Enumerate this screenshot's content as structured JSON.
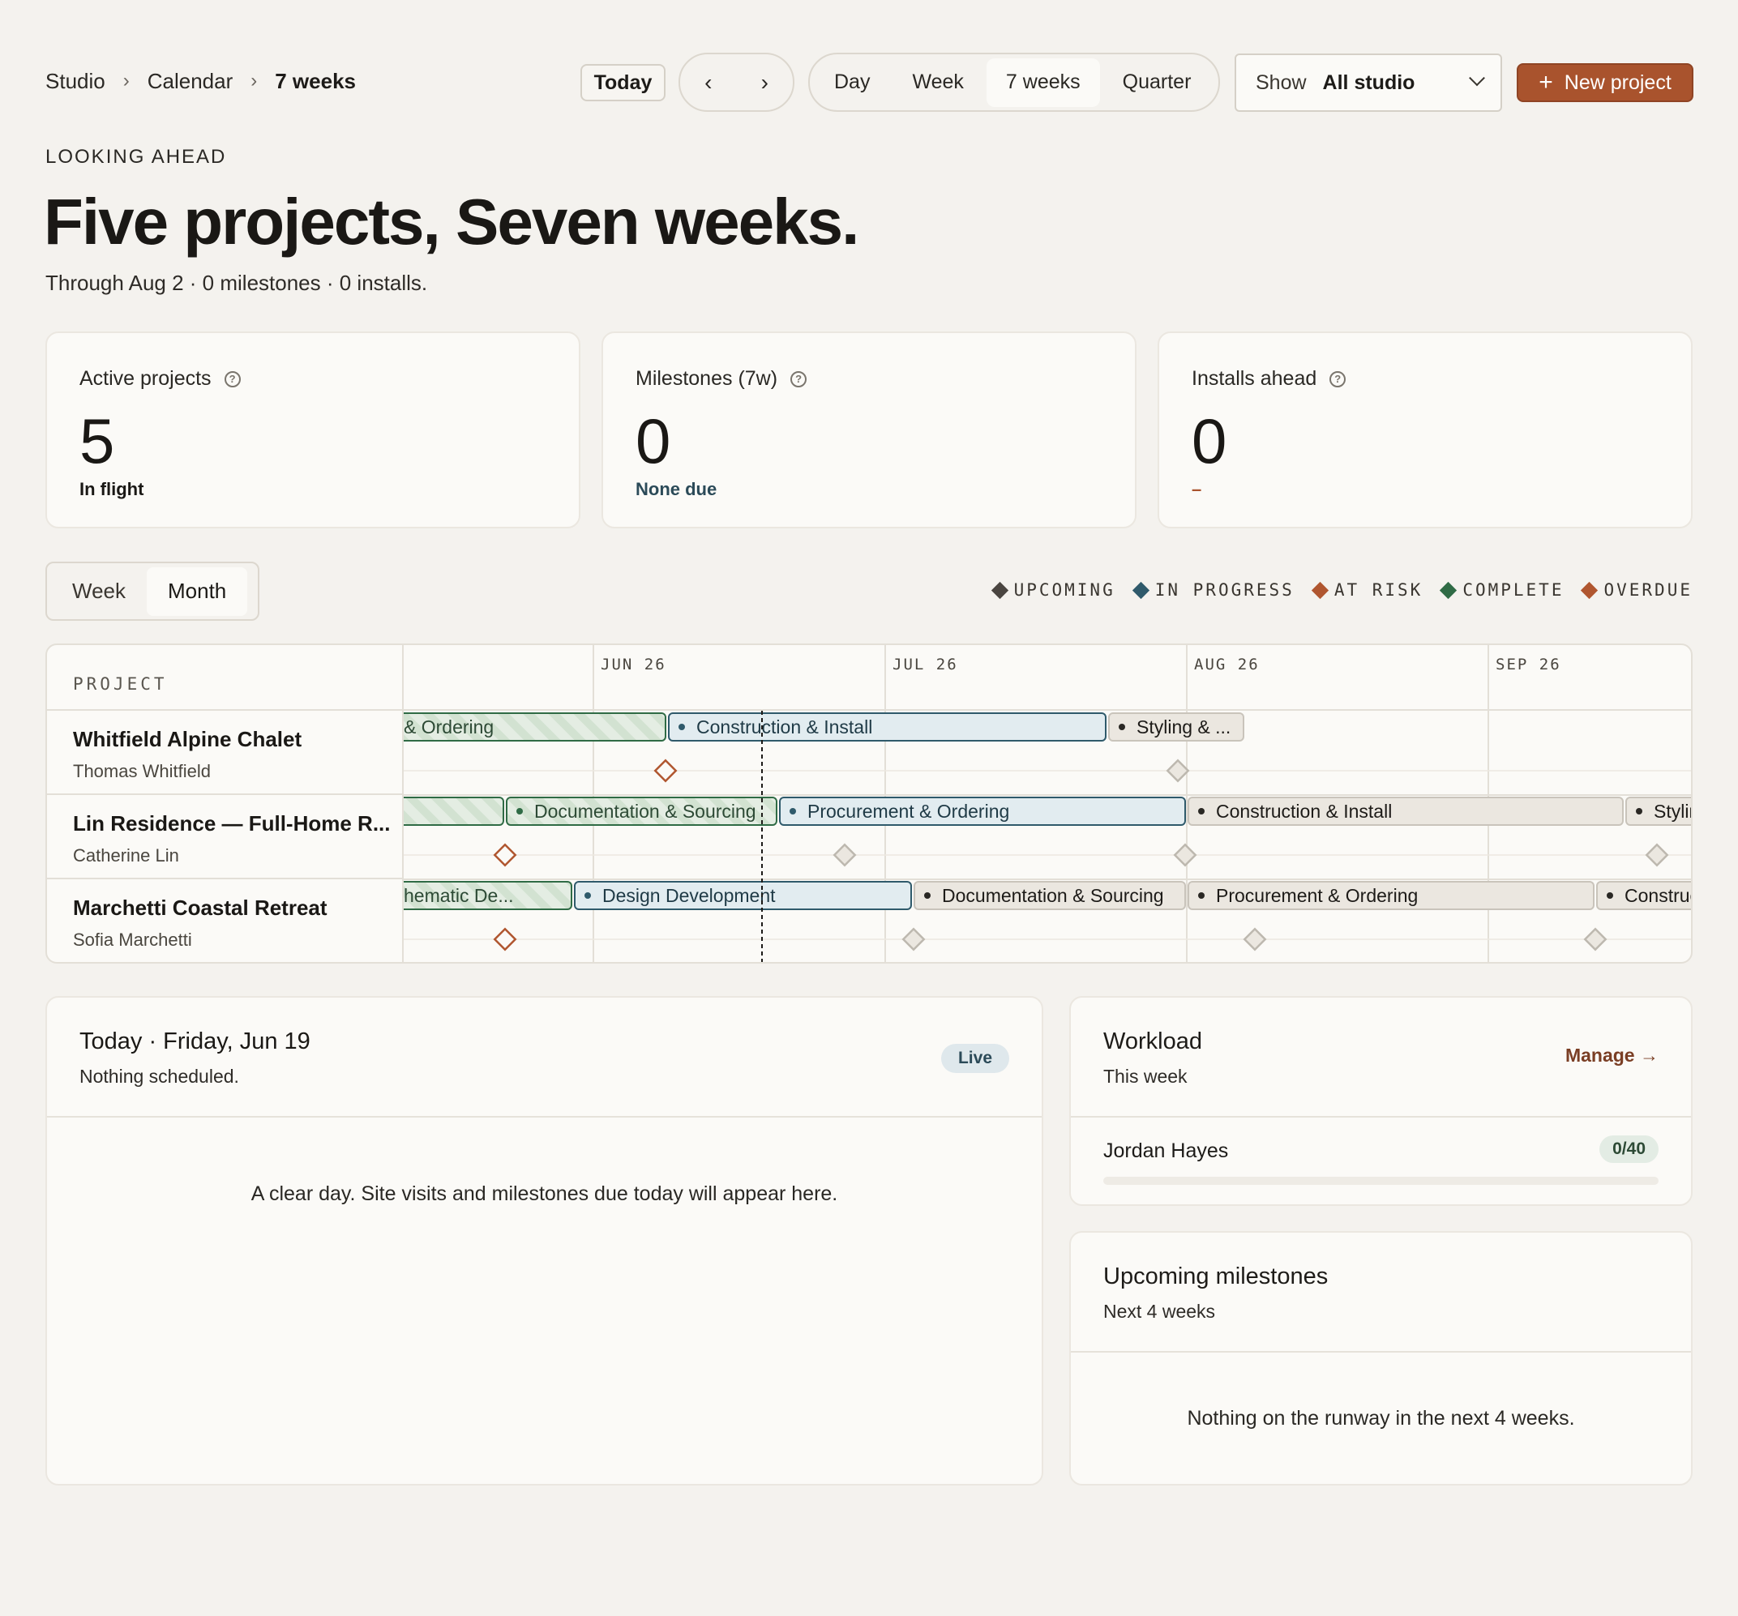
{
  "breadcrumb": {
    "items": [
      "Studio",
      "Calendar",
      "7 weeks"
    ]
  },
  "toolbar": {
    "today_label": "Today",
    "prev_label": "‹",
    "next_label": "›",
    "views": [
      "Day",
      "Week",
      "7 weeks",
      "Quarter"
    ],
    "active_view": "7 weeks",
    "show_label": "Show",
    "show_value": "All studio",
    "new_project_label": "New project"
  },
  "header": {
    "eyebrow": "LOOKING AHEAD",
    "title": "Five projects, Seven weeks.",
    "subtitle": "Through Aug 2 · 0 milestones · 0 installs."
  },
  "stats": [
    {
      "title": "Active projects",
      "value": "5",
      "note": "In flight",
      "note_color": "#1a1815"
    },
    {
      "title": "Milestones (7w)",
      "value": "0",
      "note": "None due",
      "note_color": "#2b4a58"
    },
    {
      "title": "Installs ahead",
      "value": "0",
      "note": "–",
      "note_color": "#a9532d"
    }
  ],
  "timeline": {
    "scale_options": [
      "Week",
      "Month"
    ],
    "active_scale": "Month",
    "legend": [
      {
        "label": "UPCOMING",
        "color": "#4a4540"
      },
      {
        "label": "IN PROGRESS",
        "color": "#2f5a6b"
      },
      {
        "label": "AT RISK",
        "color": "#b0562f"
      },
      {
        "label": "COMPLETE",
        "color": "#2f6b45"
      },
      {
        "label": "OVERDUE",
        "color": "#b0562f"
      }
    ],
    "project_header": "PROJECT",
    "months": [
      "JUN 26",
      "JUL 26",
      "AUG 26",
      "SEP 26"
    ],
    "projects": [
      {
        "name": "Whitfield Alpine Chalet",
        "client": "Thomas Whitfield",
        "phases": [
          {
            "label": "& Ordering",
            "status": "complete"
          },
          {
            "label": "Construction & Install",
            "status": "in-progress"
          },
          {
            "label": "Styling & ...",
            "status": "upcoming"
          }
        ],
        "milestones": [
          "overdue",
          "upcoming"
        ]
      },
      {
        "name": "Lin Residence — Full-Home R...",
        "client": "Catherine Lin",
        "phases": [
          {
            "label": "",
            "status": "complete"
          },
          {
            "label": "Documentation & Sourcing",
            "status": "complete"
          },
          {
            "label": "Procurement & Ordering",
            "status": "in-progress"
          },
          {
            "label": "Construction & Install",
            "status": "upcoming"
          },
          {
            "label": "Styling & ...",
            "status": "upcoming"
          }
        ],
        "milestones": [
          "overdue",
          "upcoming",
          "upcoming",
          "upcoming"
        ]
      },
      {
        "name": "Marchetti Coastal Retreat",
        "client": "Sofia Marchetti",
        "phases": [
          {
            "label": "hematic De...",
            "status": "complete"
          },
          {
            "label": "Design Development",
            "status": "in-progress"
          },
          {
            "label": "Documentation & Sourcing",
            "status": "upcoming"
          },
          {
            "label": "Procurement & Ordering",
            "status": "upcoming"
          },
          {
            "label": "Construction",
            "status": "upcoming"
          }
        ],
        "milestones": [
          "overdue",
          "upcoming",
          "upcoming",
          "upcoming"
        ]
      }
    ]
  },
  "today_panel": {
    "title": "Today · Friday, Jun 19",
    "subtitle": "Nothing scheduled.",
    "badge": "Live",
    "empty": "A clear day. Site visits and milestones due today will appear here."
  },
  "workload": {
    "title": "Workload",
    "subtitle": "This week",
    "manage_label": "Manage →",
    "people": [
      {
        "name": "Jordan Hayes",
        "capacity": "0/40",
        "load_fraction": 0
      }
    ]
  },
  "upcoming": {
    "title": "Upcoming milestones",
    "subtitle": "Next 4 weeks",
    "empty": "Nothing on the runway in the next 4 weeks."
  }
}
